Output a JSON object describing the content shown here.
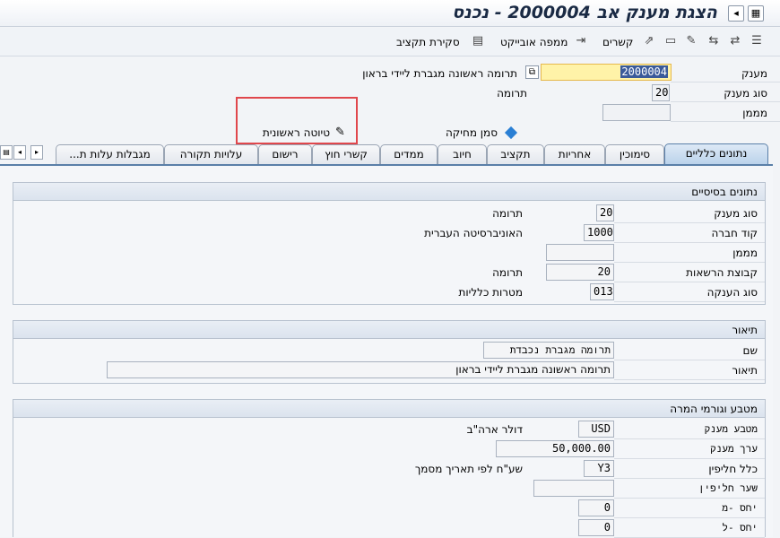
{
  "window": {
    "title": "הצגת מענק אב 2000004 - נכנס"
  },
  "toolbar": {
    "schedule_review": "סקירת תקציב",
    "object_map": "ממפה אובייקט",
    "links": "קשרים"
  },
  "header": {
    "grant_label": "מענק",
    "grant_value": "2000004",
    "grant_desc": "תרומה ראשונה מגברת ליידי בראון",
    "grant_type_label": "סוג מענק",
    "grant_type_value": "20",
    "grant_type_desc": "תרומה",
    "sponsor_label": "מממן",
    "sponsor_value": "",
    "deletion_flag_label": "סמן מחיקה",
    "first_draft_label": "טיוטה ראשונית"
  },
  "tabs": [
    {
      "label": "נתונים כלליים"
    },
    {
      "label": "סימוכין"
    },
    {
      "label": "אחריות"
    },
    {
      "label": "תקציב"
    },
    {
      "label": "חיוב"
    },
    {
      "label": "ממדים"
    },
    {
      "label": "קשרי חוץ"
    },
    {
      "label": "רישום"
    },
    {
      "label": "עלויות תקורה"
    },
    {
      "label": "מגבלות עלות ת..."
    }
  ],
  "basic_data": {
    "title": "נתונים בסיסיים",
    "rows": [
      {
        "label": "סוג מענק",
        "value": "20",
        "desc": "תרומה"
      },
      {
        "label": "קוד חברה",
        "value": "1000",
        "desc": "האוניברסיטה העברית"
      },
      {
        "label": "מממן",
        "value": "",
        "desc": ""
      },
      {
        "label": "קבוצת הרשאות",
        "value": "20",
        "desc": "תרומה"
      },
      {
        "label": "סוג הענקה",
        "value": "013",
        "desc": "מטרות כלליות"
      }
    ]
  },
  "description": {
    "title": "תיאור",
    "name_label": "שם",
    "name_value": "תרומה מגברת נכבדת",
    "desc_label": "תיאור",
    "desc_value": "תרומה ראשונה מגברת ליידי בראון"
  },
  "currency": {
    "title": "מטבע וגורמי המרה",
    "rows": [
      {
        "label": "מטבע מענק",
        "value": "USD",
        "desc": "דולר ארה\"ב"
      },
      {
        "label": "ערך מענק",
        "value": "50,000.00",
        "desc": ""
      },
      {
        "label": "כלל חליפין",
        "value": "Y3",
        "desc": "שע\"ח לפי תאריך מסמך"
      },
      {
        "label": "שער חליפין",
        "value": "",
        "desc": ""
      },
      {
        "label": "יחס -מ",
        "value": "0",
        "desc": ""
      },
      {
        "label": "יחס -ל",
        "value": "0",
        "desc": ""
      }
    ]
  }
}
